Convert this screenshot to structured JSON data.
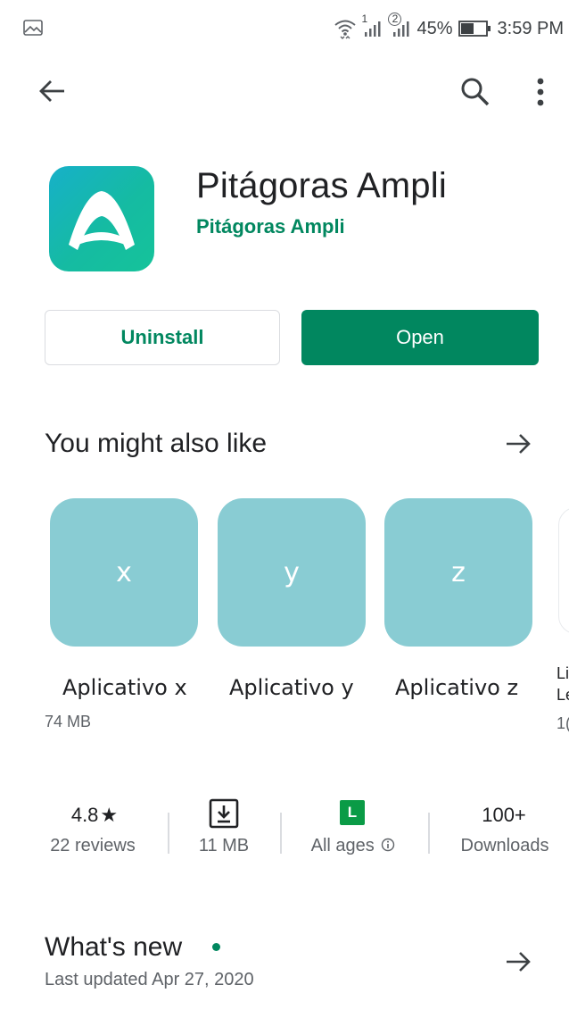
{
  "status_bar": {
    "battery": "45%",
    "time": "3:59 PM",
    "sim1": "1",
    "sim2": "2",
    "left_icon": "image-icon",
    "icons": [
      "wifi-icon",
      "signal-sim1-icon",
      "signal-sim2-icon",
      "battery-icon"
    ]
  },
  "top_bar": {
    "back_icon": "back-arrow-icon",
    "search_icon": "search-icon",
    "menu_icon": "more-vert-icon"
  },
  "app": {
    "name": "Pitágoras Ampli",
    "developer": "Pitágoras Ampli",
    "icon": "pitagoras-ampli-logo"
  },
  "actions": {
    "uninstall_label": "Uninstall",
    "open_label": "Open"
  },
  "similar": {
    "title": "You might also like",
    "apps": [
      {
        "tile_text": "x",
        "name": "Aplicativo x",
        "size": "74 MB"
      },
      {
        "tile_text": "y",
        "name": "Aplicativo y",
        "size": ""
      },
      {
        "tile_text": "z",
        "name": "Aplicativo z",
        "size": ""
      }
    ],
    "partial": {
      "line1": "Li",
      "line2": "Le",
      "size": "1("
    }
  },
  "stats": {
    "rating": "4.8",
    "rating_star": "★",
    "reviews": "22 reviews",
    "size": "11 MB",
    "content_rating_badge": "L",
    "content_rating": "All ages",
    "downloads_count": "100+",
    "downloads_label": "Downloads"
  },
  "whats_new": {
    "title": "What's new",
    "updated": "Last updated Apr 27, 2020"
  },
  "colors": {
    "accent": "#01875f",
    "tile": "#89ccd3",
    "icon_gradient_start": "#17b0c9",
    "icon_gradient_end": "#15c39a"
  }
}
